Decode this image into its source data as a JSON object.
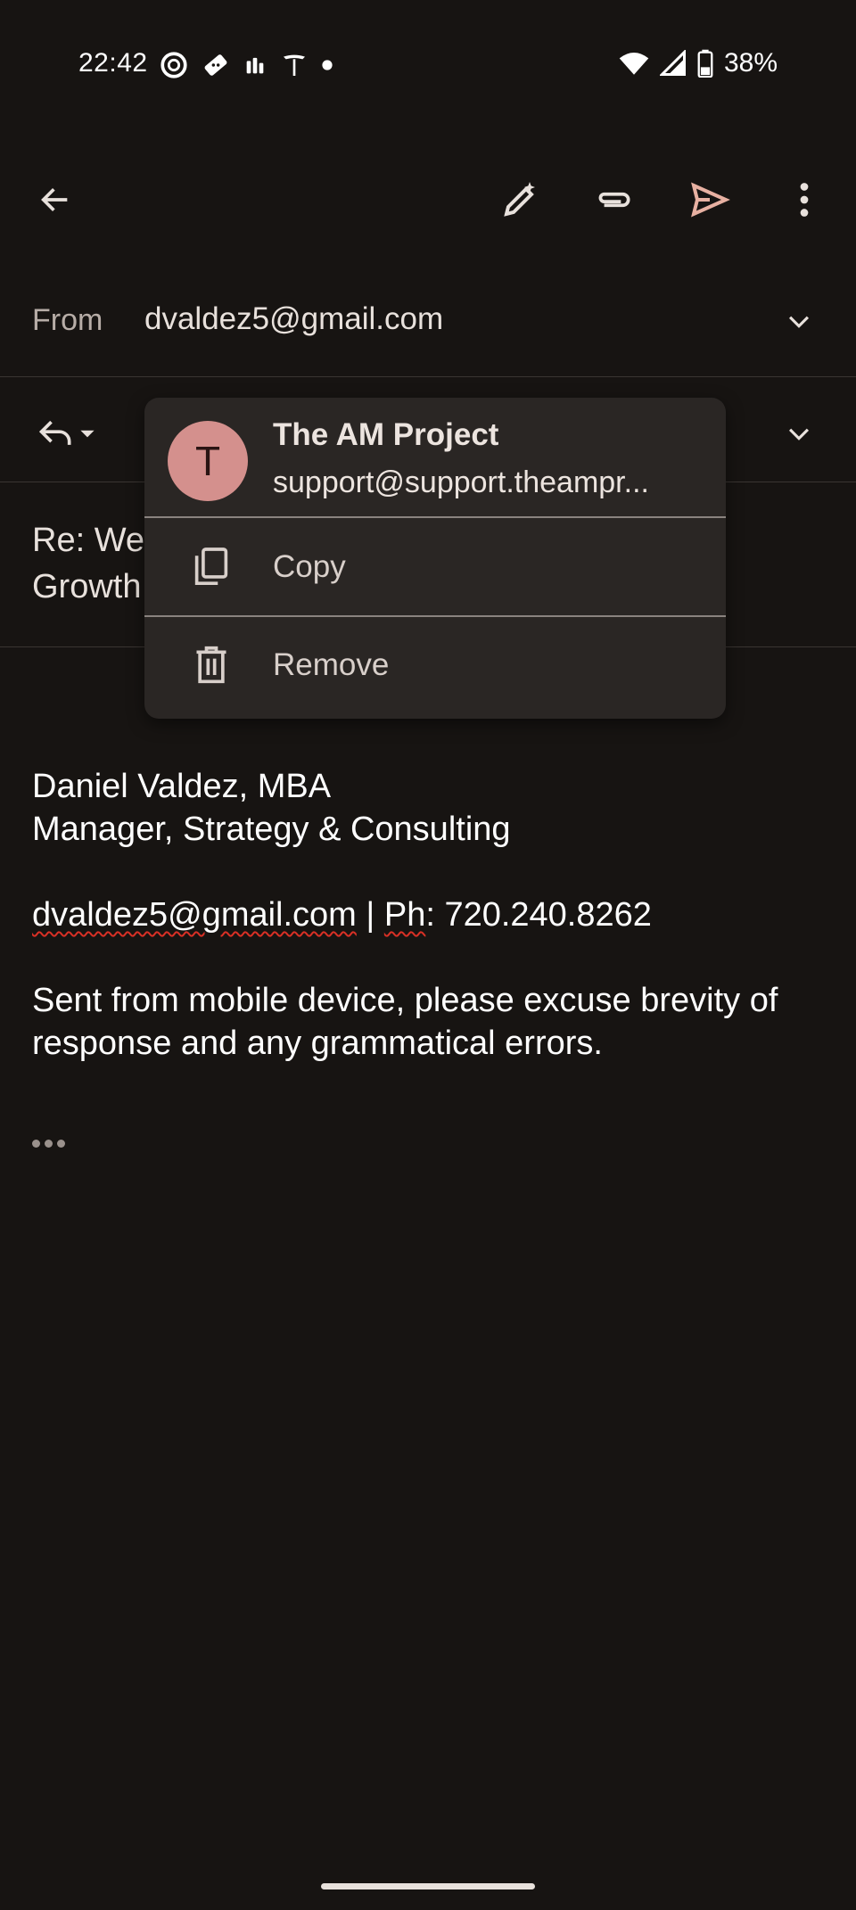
{
  "status_bar": {
    "time": "22:42",
    "battery": "38%",
    "left_icons": [
      "chatgpt-icon",
      "ticket-icon",
      "stepper-icon",
      "tesla-icon",
      "dot-icon"
    ],
    "right_icons": [
      "wifi-icon",
      "signal-icon",
      "battery-icon"
    ]
  },
  "toolbar": {
    "icons": [
      "back-arrow-icon",
      "ai-pencil-icon",
      "attachment-icon",
      "send-icon",
      "more-vert-icon"
    ]
  },
  "compose": {
    "from_label": "From",
    "from_value": "dvaldez5@gmail.com",
    "subject_line1": "Re: We",
    "subject_line2": "Growth"
  },
  "popup": {
    "avatar_letter": "T",
    "contact_name": "The AM Project",
    "contact_email": "support@support.theampr...",
    "copy_label": "Copy",
    "remove_label": "Remove",
    "avatar_color": "#d4908d"
  },
  "body": {
    "sig_name": "Daniel Valdez, MBA",
    "sig_title": "Manager, Strategy & Consulting",
    "contact_email": "dvaldez5@gmail.com",
    "contact_sep": " | ",
    "contact_ph": "Ph",
    "contact_phone": ": 720.240.8262",
    "disclaimer_line1": "Sent from mobile device, please excuse brevity of",
    "disclaimer_line2": "response and any grammatical errors."
  },
  "colors": {
    "background": "#171412",
    "accent_send": "#e8b1a2",
    "popup_bg": "#2a2624"
  }
}
